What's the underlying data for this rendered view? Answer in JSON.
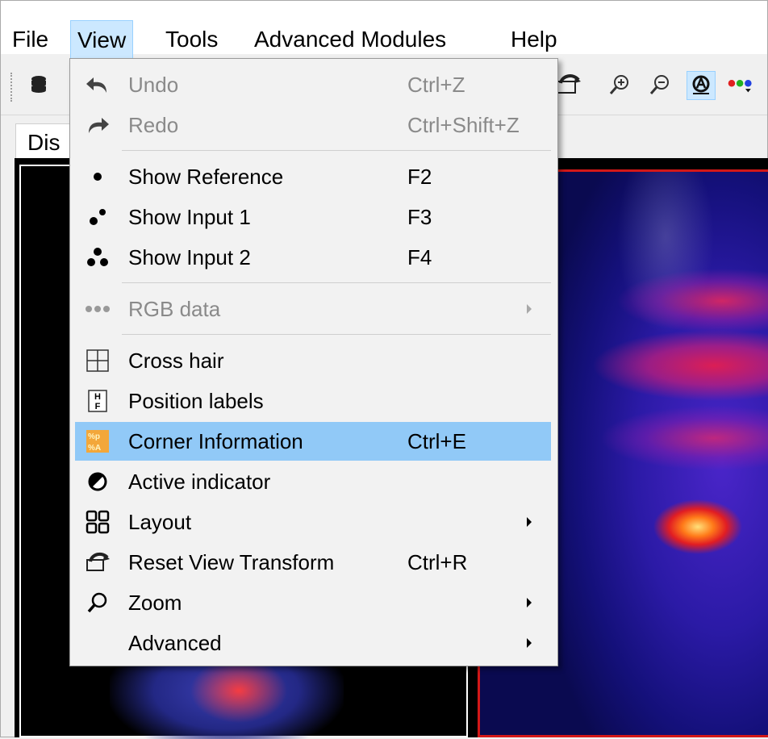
{
  "menubar": {
    "items": [
      "File",
      "View",
      "Tools",
      "Advanced Modules",
      "Help"
    ],
    "open_menu": "View"
  },
  "toolbar": {
    "buttons": [
      "database-icon",
      "reset-view-icon",
      "zoom-in-icon",
      "zoom-out-icon",
      "active-indicator-icon",
      "rgb-data-icon"
    ],
    "active_button": "active-indicator-icon"
  },
  "tabs": {
    "active_label": "Dis"
  },
  "view_menu": {
    "items": [
      {
        "label": "Undo",
        "shortcut": "Ctrl+Z",
        "icon": "undo-icon",
        "enabled": false
      },
      {
        "label": "Redo",
        "shortcut": "Ctrl+Shift+Z",
        "icon": "redo-icon",
        "enabled": false
      },
      {
        "label": "Show Reference",
        "shortcut": "F2",
        "icon": "one-dot-icon",
        "enabled": true
      },
      {
        "label": "Show Input 1",
        "shortcut": "F3",
        "icon": "two-dots-icon",
        "enabled": true
      },
      {
        "label": "Show Input 2",
        "shortcut": "F4",
        "icon": "three-dots-icon",
        "enabled": true
      },
      {
        "label": "RGB data",
        "shortcut": "",
        "icon": "rgb-dots-icon",
        "enabled": false,
        "submenu": true
      },
      {
        "label": "Cross hair",
        "shortcut": "",
        "icon": "crosshair-icon",
        "enabled": true
      },
      {
        "label": "Position labels",
        "shortcut": "",
        "icon": "position-labels-icon",
        "enabled": true
      },
      {
        "label": "Corner Information",
        "shortcut": "Ctrl+E",
        "icon": "corner-info-icon",
        "enabled": true,
        "highlighted": true
      },
      {
        "label": "Active indicator",
        "shortcut": "",
        "icon": "half-circle-icon",
        "enabled": true
      },
      {
        "label": "Layout",
        "shortcut": "",
        "icon": "layout-grid-icon",
        "enabled": true,
        "submenu": true
      },
      {
        "label": "Reset View Transform",
        "shortcut": "Ctrl+R",
        "icon": "reset-view-icon",
        "enabled": true
      },
      {
        "label": "Zoom",
        "shortcut": "",
        "icon": "zoom-icon",
        "enabled": true,
        "submenu": true
      },
      {
        "label": "Advanced",
        "shortcut": "",
        "icon": "",
        "enabled": true,
        "submenu": true
      }
    ]
  },
  "position_labels_icon_text": [
    "H",
    "F"
  ],
  "corner_info_icon_text": [
    "%p",
    "%A"
  ],
  "colors": {
    "menu_highlight": "#91c9f7",
    "open_menu_bg": "#cce8ff",
    "disabled_text": "#8a8a8a",
    "viewport_border_active": "#d31818"
  }
}
